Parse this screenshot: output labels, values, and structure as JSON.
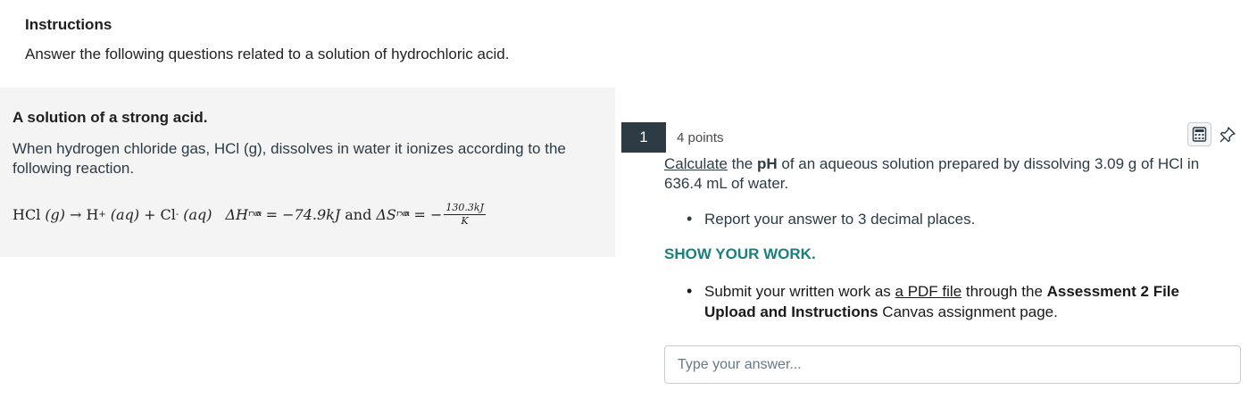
{
  "instructions": {
    "title": "Instructions",
    "text": "Answer the following questions related to a solution of hydrochloric acid."
  },
  "left_panel": {
    "title": "A solution of a strong acid.",
    "text": "When hydrogen chloride gas, HCl (g), dissolves in water it ionizes according to the following reaction.",
    "equation": {
      "reactant": "HCl",
      "reactant_state": "(g)",
      "arrow": "→",
      "product1": "H",
      "product1_charge": "+",
      "product1_state": "(aq)",
      "plus": "+",
      "product2": "Cl",
      "product2_charge": "-",
      "product2_state": "(aq)",
      "dh_symbol": "ΔH",
      "dh_sub": "rxn",
      "dh_sup": "o",
      "dh_value": "= −74.9kJ",
      "and": "and",
      "ds_symbol": "ΔS",
      "ds_sub": "rxn",
      "ds_sup": "o",
      "ds_eq": "= −",
      "ds_num": "130.3kJ",
      "ds_den": "K"
    }
  },
  "question": {
    "number": "1",
    "points": "4 points",
    "calc_word": "Calculate",
    "text_a": " the ",
    "ph": "pH",
    "text_b": " of an aqueous solution prepared by dissolving 3.09 g of HCl in 636.4 mL of water.",
    "bullet1": "Report your answer to 3 decimal places.",
    "show_work": "SHOW YOUR WORK.",
    "bullet2_a": "Submit your written work as ",
    "bullet2_link": "a PDF file",
    "bullet2_b": " through the ",
    "bullet2_bold": "Assessment 2 File Upload and Instructions",
    "bullet2_c": " Canvas assignment page.",
    "answer_placeholder": "Type your answer..."
  },
  "icons": {
    "calculator": "calculator-icon",
    "pin": "pin-icon"
  }
}
